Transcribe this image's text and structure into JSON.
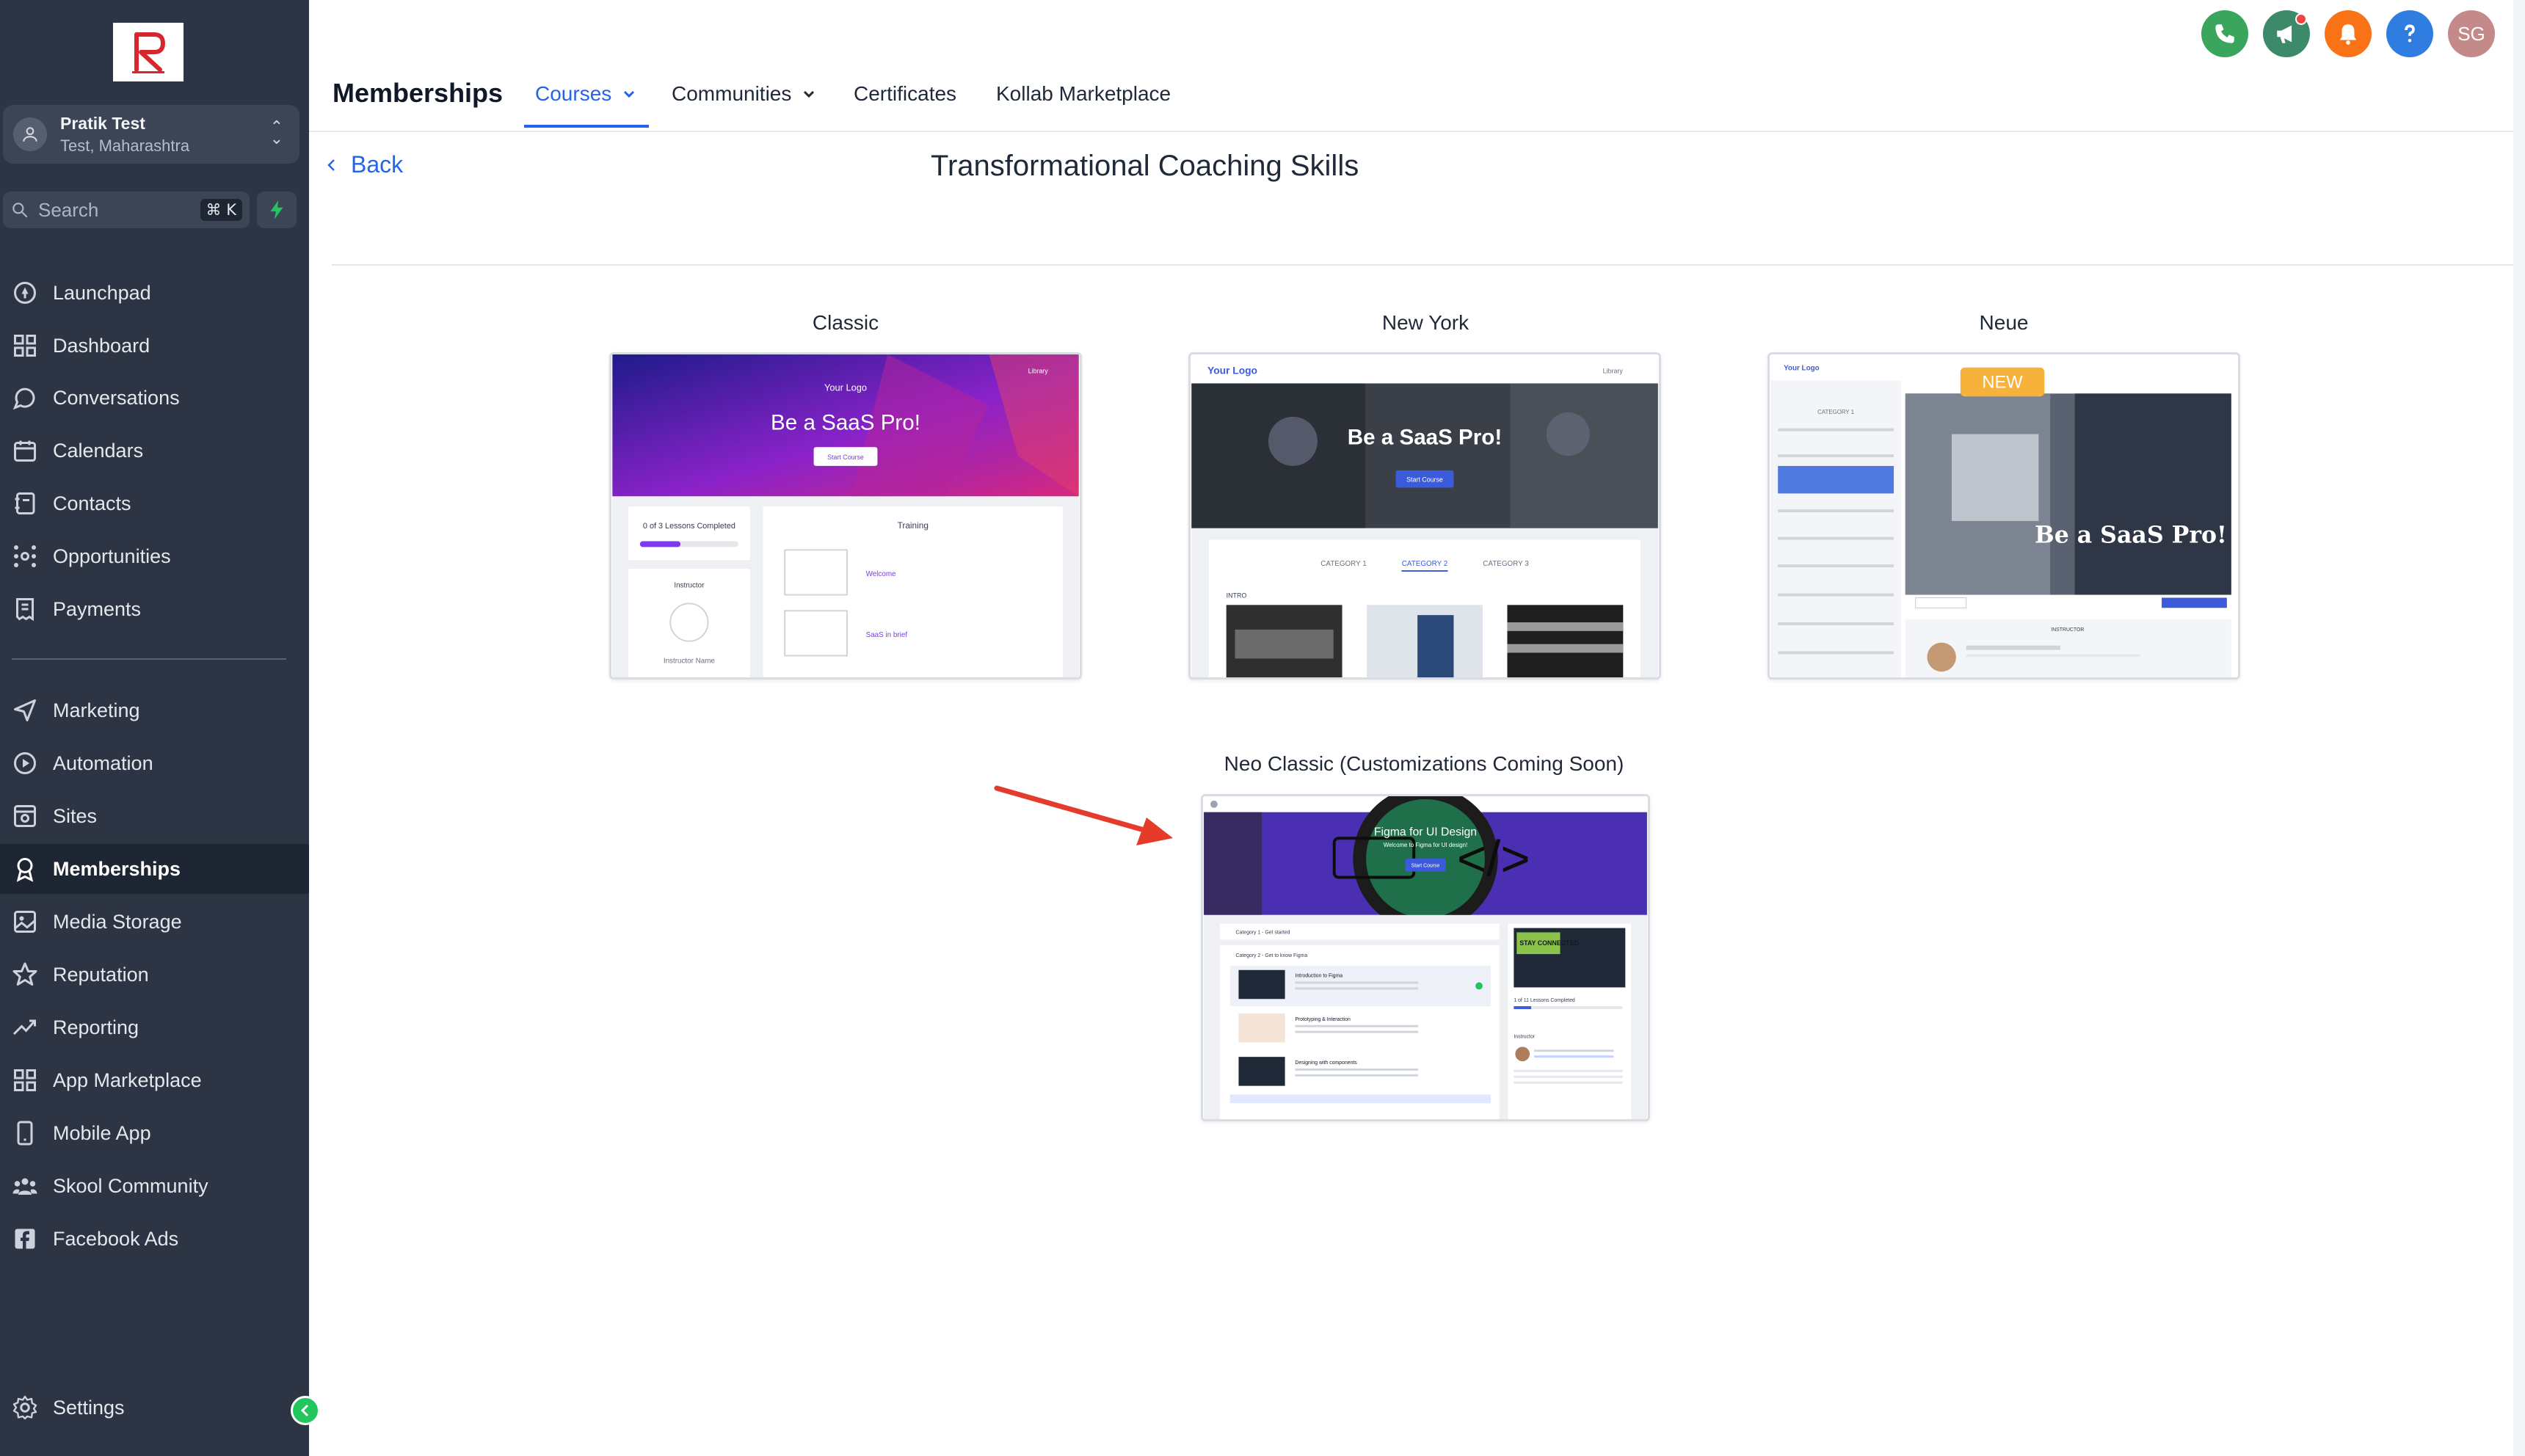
{
  "sidebar": {
    "account": {
      "name": "Pratik Test",
      "location": "Test, Maharashtra"
    },
    "search": {
      "placeholder": "Search",
      "shortcut": "⌘ K"
    },
    "items": [
      {
        "label": "Launchpad",
        "icon": "rocket-icon"
      },
      {
        "label": "Dashboard",
        "icon": "grid-icon"
      },
      {
        "label": "Conversations",
        "icon": "chat-icon"
      },
      {
        "label": "Calendars",
        "icon": "calendar-icon"
      },
      {
        "label": "Contacts",
        "icon": "contacts-icon"
      },
      {
        "label": "Opportunities",
        "icon": "network-icon"
      },
      {
        "label": "Payments",
        "icon": "receipt-icon"
      },
      {
        "label": "Marketing",
        "icon": "send-icon"
      },
      {
        "label": "Automation",
        "icon": "automation-icon"
      },
      {
        "label": "Sites",
        "icon": "sites-icon"
      },
      {
        "label": "Memberships",
        "icon": "award-icon",
        "active": true
      },
      {
        "label": "Media Storage",
        "icon": "image-icon"
      },
      {
        "label": "Reputation",
        "icon": "star-icon"
      },
      {
        "label": "Reporting",
        "icon": "trend-icon"
      },
      {
        "label": "App Marketplace",
        "icon": "apps-icon"
      },
      {
        "label": "Mobile App",
        "icon": "phone-icon"
      },
      {
        "label": "Skool Community",
        "icon": "users-icon"
      },
      {
        "label": "Facebook Ads",
        "icon": "facebook-icon"
      }
    ],
    "settings_label": "Settings"
  },
  "header": {
    "title": "Memberships",
    "tabs": [
      {
        "label": "Courses",
        "active": true,
        "dropdown": true
      },
      {
        "label": "Communities",
        "dropdown": true
      },
      {
        "label": "Certificates"
      },
      {
        "label": "Kollab Marketplace"
      }
    ],
    "avatar_initials": "SG",
    "colors": {
      "phone": "#3aa55d",
      "megaphone": "#3d8a6b",
      "bell": "#f97316",
      "help": "#2f7de1",
      "avatar": "#c48a8a",
      "accent": "#2563eb"
    }
  },
  "content": {
    "back_label": "Back",
    "course_title": "Transformational Coaching Skills",
    "templates": [
      {
        "name": "Classic",
        "preview": {
          "logo": "Your Logo",
          "hero": "Be a SaaS Pro!",
          "button": "Start Course",
          "progress": "0 of 3 Lessons Completed",
          "menu": "Library",
          "section": "Training",
          "instructor_heading": "Instructor",
          "instructor_name": "Instructor Name",
          "lessons": [
            "Welcome",
            "SaaS in brief"
          ]
        }
      },
      {
        "name": "New York",
        "preview": {
          "logo": "Your Logo",
          "hero": "Be a SaaS Pro!",
          "button": "Start Course",
          "menu": "Library",
          "categories": [
            "CATEGORY 1",
            "CATEGORY 2",
            "CATEGORY 3"
          ],
          "section": "INTRO"
        }
      },
      {
        "name": "Neue",
        "badge": "NEW",
        "preview": {
          "logo": "Your Logo",
          "hero": "Be a SaaS Pro!",
          "category": "CATEGORY 1",
          "section": "INSTRUCTOR"
        }
      },
      {
        "name": "Neo Classic (Customizations Coming Soon)",
        "preview": {
          "hero": "Figma for UI Design",
          "subtitle": "Welcome to Figma for UI design!",
          "button": "Start Course",
          "categories": [
            "Category 1 - Get started",
            "Category 2 - Get to know Figma"
          ],
          "lessons": [
            "Introduction to Figma",
            "Prototyping & Interaction",
            "Designing with components"
          ],
          "progress": "1 of 11 Lessons Completed",
          "instructor_heading": "Instructor",
          "promo": "STAY CONNECTED"
        }
      }
    ]
  }
}
